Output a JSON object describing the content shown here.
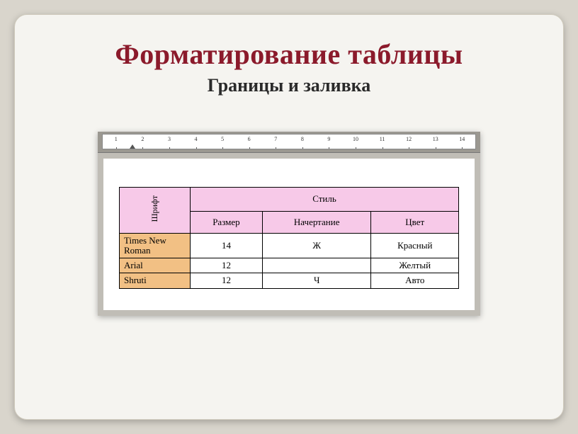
{
  "title": "Форматирование таблицы",
  "subtitle": "Границы и заливка",
  "ruler": [
    "1",
    "2",
    "3",
    "4",
    "5",
    "6",
    "7",
    "8",
    "9",
    "10",
    "11",
    "12",
    "13",
    "14"
  ],
  "table": {
    "fontHeader": "Шрифт",
    "styleHeader": "Стиль",
    "subHeaders": {
      "size": "Размер",
      "style": "Начертание",
      "color": "Цвет"
    },
    "rows": [
      {
        "font": "Times New Roman",
        "size": "14",
        "style": "Ж",
        "color": "Красный"
      },
      {
        "font": "Arial",
        "size": "12",
        "style": "",
        "color": "Желтый"
      },
      {
        "font": "Shruti",
        "size": "12",
        "style": "Ч",
        "color": "Авто"
      }
    ]
  }
}
